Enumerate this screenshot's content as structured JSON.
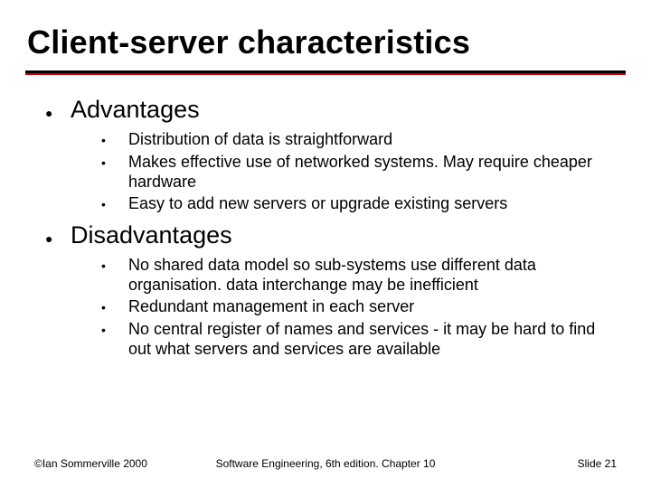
{
  "title": "Client-server characteristics",
  "sections": {
    "advantages": {
      "heading": "Advantages",
      "items": [
        "Distribution of data is straightforward",
        "Makes effective use of networked systems. May require cheaper hardware",
        "Easy to add new servers or upgrade existing servers"
      ]
    },
    "disadvantages": {
      "heading": "Disadvantages",
      "items": [
        "No shared data model so sub-systems use different data organisation. data interchange may be inefficient",
        "Redundant management in each server",
        "No central register of names and services - it may be hard to find out what servers and services are available"
      ]
    }
  },
  "footer": {
    "left": "©Ian Sommerville 2000",
    "center": "Software Engineering, 6th edition. Chapter 10",
    "right": "Slide 21"
  }
}
